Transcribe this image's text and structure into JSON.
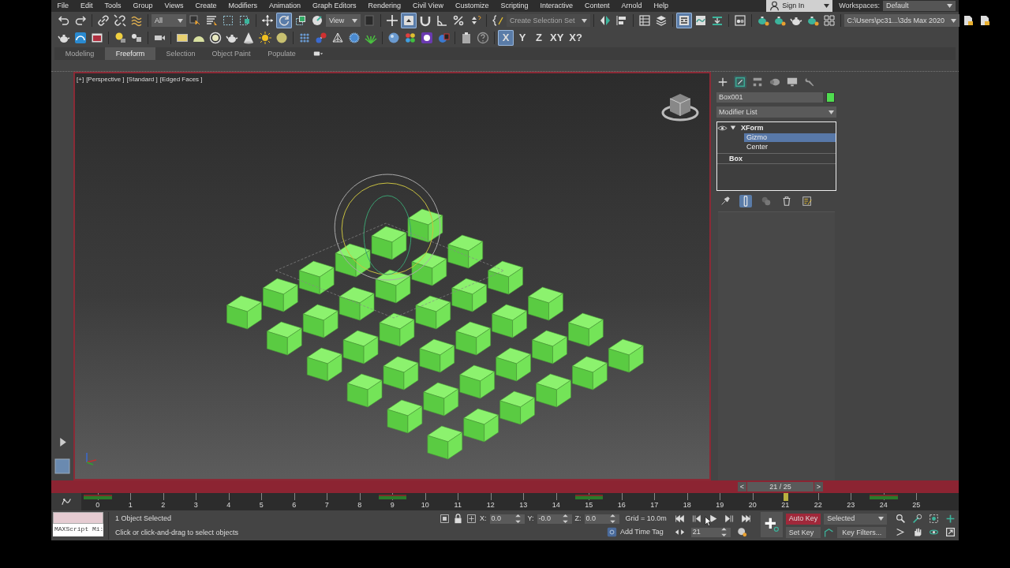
{
  "menu_bar": {
    "menus": [
      "File",
      "Edit",
      "Tools",
      "Group",
      "Views",
      "Create",
      "Modifiers",
      "Animation",
      "Graph Editors",
      "Rendering",
      "Civil View",
      "Customize",
      "Scripting",
      "Interactive",
      "Content",
      "Arnold",
      "Help"
    ],
    "sign_in": "Sign In",
    "workspaces_label": "Workspaces:",
    "workspace": "Default"
  },
  "main_toolbar": [
    [
      {
        "kind": "tool",
        "selected": false
      },
      {
        "kind": "tool",
        "selected": false
      }
    ],
    [
      {
        "kind": "tool",
        "selected": false
      },
      {
        "kind": "tool",
        "selected": false
      },
      {
        "kind": "tool",
        "selected": false
      }
    ],
    [
      {
        "kind": "dropdown",
        "value": "All",
        "disabled": false
      },
      {
        "kind": "tool",
        "selected": false
      },
      {
        "kind": "tool",
        "selected": false
      },
      {
        "kind": "tool",
        "selected": false
      },
      {
        "kind": "tool",
        "selected": false
      }
    ],
    [
      {
        "kind": "tool",
        "selected": false
      },
      {
        "kind": "tool",
        "selected": true
      },
      {
        "kind": "tool",
        "selected": false
      },
      {
        "kind": "tool",
        "selected": false
      },
      {
        "kind": "dropdown",
        "value": "View",
        "disabled": false
      },
      {
        "kind": "tool",
        "selected": false
      }
    ],
    [
      {
        "kind": "tool",
        "selected": false
      },
      {
        "kind": "tool",
        "selected": true
      },
      {
        "kind": "tool",
        "selected": false
      },
      {
        "kind": "tool",
        "selected": false
      },
      {
        "kind": "tool",
        "selected": false
      },
      {
        "kind": "tool",
        "selected": false
      }
    ],
    [
      {
        "kind": "tool",
        "selected": false
      },
      {
        "kind": "dropdown",
        "value": "Create Selection Set",
        "disabled": true
      }
    ],
    [
      {
        "kind": "tool",
        "selected": false
      },
      {
        "kind": "tool",
        "selected": false
      }
    ],
    [
      {
        "kind": "tool",
        "selected": false
      },
      {
        "kind": "tool",
        "selected": false
      }
    ],
    [
      {
        "kind": "tool",
        "selected": true
      },
      {
        "kind": "tool",
        "selected": false
      },
      {
        "kind": "tool",
        "selected": false
      }
    ],
    [
      {
        "kind": "tool",
        "selected": false
      }
    ],
    [
      {
        "kind": "tool",
        "selected": false
      },
      {
        "kind": "tool",
        "selected": false
      },
      {
        "kind": "tool",
        "selected": false
      },
      {
        "kind": "tool",
        "selected": false
      },
      {
        "kind": "tool",
        "selected": false
      }
    ],
    [
      {
        "kind": "dropdown",
        "value": "C:\\Users\\pc31...\\3ds Max 2020",
        "disabled": false
      },
      {
        "kind": "tool",
        "selected": false
      },
      {
        "kind": "tool",
        "selected": false
      }
    ]
  ],
  "second_toolbar": [
    [
      {
        "kind": "tool",
        "selected": false
      },
      {
        "kind": "tool",
        "selected": false
      },
      {
        "kind": "tool",
        "selected": false
      }
    ],
    [
      {
        "kind": "tool",
        "selected": false
      },
      {
        "kind": "tool",
        "selected": false
      }
    ],
    [
      {
        "kind": "tool",
        "selected": false
      }
    ],
    [
      {
        "kind": "tool",
        "selected": false
      },
      {
        "kind": "tool",
        "selected": false
      },
      {
        "kind": "tool",
        "selected": false
      },
      {
        "kind": "tool",
        "selected": false
      },
      {
        "kind": "tool",
        "selected": false
      },
      {
        "kind": "tool",
        "selected": false
      },
      {
        "kind": "tool",
        "selected": false
      }
    ],
    [
      {
        "kind": "tool",
        "selected": false
      },
      {
        "kind": "tool",
        "selected": false
      },
      {
        "kind": "tool",
        "selected": false
      },
      {
        "kind": "tool",
        "selected": false
      },
      {
        "kind": "tool",
        "selected": false
      }
    ],
    [
      {
        "kind": "tool",
        "selected": false
      },
      {
        "kind": "tool",
        "selected": false
      },
      {
        "kind": "tool",
        "selected": false
      },
      {
        "kind": "tool",
        "selected": false
      }
    ],
    [
      {
        "kind": "tool",
        "selected": false
      },
      {
        "kind": "tool",
        "selected": false
      }
    ],
    [
      {
        "kind": "axis",
        "label": "X",
        "selected": true
      },
      {
        "kind": "axis",
        "label": "Y",
        "selected": false
      },
      {
        "kind": "axis",
        "label": "Z",
        "selected": false
      },
      {
        "kind": "axis",
        "label": "XY",
        "selected": false
      },
      {
        "kind": "axis",
        "label": "X?",
        "selected": false
      }
    ]
  ],
  "ribbon_tabs": [
    {
      "label": "Modeling",
      "selected": false
    },
    {
      "label": "Freeform",
      "selected": true
    },
    {
      "label": "Selection",
      "selected": false
    },
    {
      "label": "Object Paint",
      "selected": false
    },
    {
      "label": "Populate",
      "selected": false
    }
  ],
  "viewport": {
    "labels": [
      "[+]",
      "[Perspective ]",
      "[Standard ]",
      "[Edged Faces ]"
    ]
  },
  "command_panel": {
    "tabs": [
      {
        "selected": false
      },
      {
        "selected": true
      },
      {
        "selected": false
      },
      {
        "selected": false
      },
      {
        "selected": false
      },
      {
        "selected": false
      }
    ],
    "object_name": "Box001",
    "modifier_list": "Modifier List",
    "stack": [
      {
        "label": "XForm",
        "expanded": true,
        "selected": false,
        "children": [
          {
            "label": "Gizmo",
            "selected": true
          },
          {
            "label": "Center",
            "selected": false
          }
        ]
      },
      {
        "label": "Box",
        "selected": false
      }
    ],
    "stack_tools": [
      {
        "selected": false
      },
      {
        "selected": true
      },
      {
        "selected": false
      },
      {
        "selected": false
      },
      {
        "selected": false
      }
    ]
  },
  "time_slider": {
    "prev": "<",
    "label": "21 / 25",
    "next": ">"
  },
  "track_bar": {
    "ticks": [
      {
        "label": "0",
        "key": true,
        "current": false
      },
      {
        "label": "1",
        "key": false,
        "current": false
      },
      {
        "label": "2",
        "key": false,
        "current": false
      },
      {
        "label": "3",
        "key": false,
        "current": false
      },
      {
        "label": "4",
        "key": false,
        "current": false
      },
      {
        "label": "5",
        "key": false,
        "current": false
      },
      {
        "label": "6",
        "key": false,
        "current": false
      },
      {
        "label": "7",
        "key": false,
        "current": false
      },
      {
        "label": "8",
        "key": false,
        "current": false
      },
      {
        "label": "9",
        "key": true,
        "current": false
      },
      {
        "label": "10",
        "key": false,
        "current": false
      },
      {
        "label": "11",
        "key": false,
        "current": false
      },
      {
        "label": "12",
        "key": false,
        "current": false
      },
      {
        "label": "13",
        "key": false,
        "current": false
      },
      {
        "label": "14",
        "key": false,
        "current": false
      },
      {
        "label": "15",
        "key": true,
        "current": false
      },
      {
        "label": "16",
        "key": false,
        "current": false
      },
      {
        "label": "17",
        "key": false,
        "current": false
      },
      {
        "label": "18",
        "key": false,
        "current": false
      },
      {
        "label": "19",
        "key": false,
        "current": false
      },
      {
        "label": "20",
        "key": false,
        "current": false
      },
      {
        "label": "21",
        "key": false,
        "current": true
      },
      {
        "label": "22",
        "key": false,
        "current": false
      },
      {
        "label": "23",
        "key": false,
        "current": false
      },
      {
        "label": "24",
        "key": true,
        "current": false
      },
      {
        "label": "25",
        "key": false,
        "current": false
      }
    ]
  },
  "status": {
    "maxscript_hint": "MAXScript Mi:",
    "selection": "1 Object Selected",
    "prompt": "Click or click-and-drag to select objects",
    "coords": [
      {
        "axis": "X:",
        "value": "0.0"
      },
      {
        "axis": "Y:",
        "value": "-0.0"
      },
      {
        "axis": "Z:",
        "value": "0.0"
      }
    ],
    "grid": "Grid = 10.0m",
    "add_time_tag": "Add Time Tag",
    "frame": "21",
    "auto_key": {
      "label": "Auto Key",
      "on": true
    },
    "key_mode": "Selected",
    "set_key": "Set Key",
    "key_filters": "Key Filters..."
  }
}
